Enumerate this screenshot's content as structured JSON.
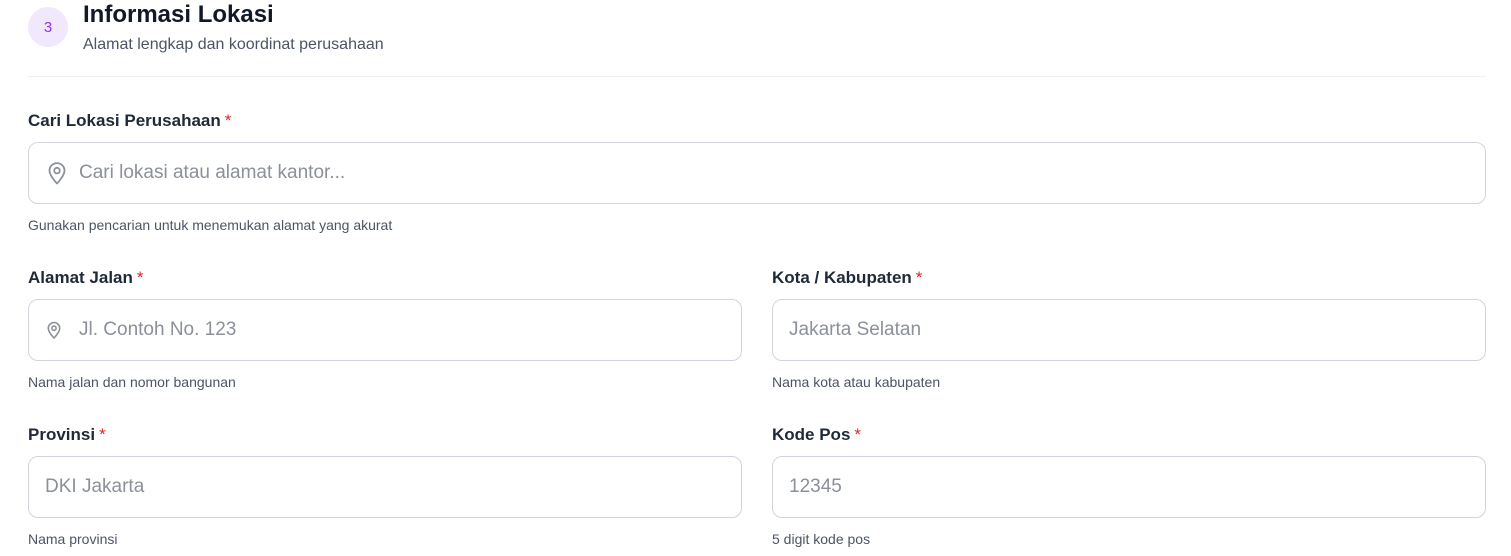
{
  "section": {
    "step_number": "3",
    "title": "Informasi Lokasi",
    "subtitle": "Alamat lengkap dan koordinat perusahaan"
  },
  "fields": {
    "search": {
      "label": "Cari Lokasi Perusahaan",
      "required_mark": "*",
      "placeholder": "Cari lokasi atau alamat kantor...",
      "value": "",
      "hint": "Gunakan pencarian untuk menemukan alamat yang akurat",
      "icon": "map-pin-icon"
    },
    "street": {
      "label": "Alamat Jalan",
      "required_mark": "*",
      "placeholder": "Jl. Contoh No. 123",
      "value": "",
      "hint": "Nama jalan dan nomor bangunan",
      "icon": "map-pin-icon"
    },
    "city": {
      "label": "Kota / Kabupaten",
      "required_mark": "*",
      "placeholder": "Jakarta Selatan",
      "value": "",
      "hint": "Nama kota atau kabupaten"
    },
    "province": {
      "label": "Provinsi",
      "required_mark": "*",
      "placeholder": "DKI Jakarta",
      "value": "",
      "hint": "Nama provinsi"
    },
    "postal_code": {
      "label": "Kode Pos",
      "required_mark": "*",
      "placeholder": "12345",
      "value": "",
      "hint": "5 digit kode pos"
    }
  },
  "colors": {
    "accent": "#9333ea",
    "accent_bg": "#f1e8fd",
    "required": "#dc2626",
    "border": "#d1d5db"
  }
}
